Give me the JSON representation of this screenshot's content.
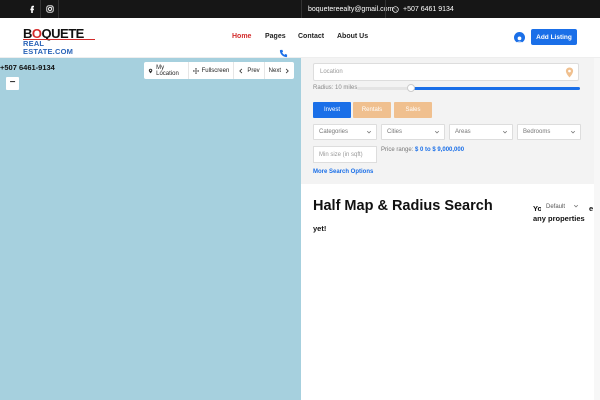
{
  "topbar": {
    "facebook_icon": "facebook-icon",
    "instagram_icon": "instagram-icon",
    "email": "boquetereealty@gmail.com",
    "phone": "+507 6461 9134",
    "bg_color": "#161616"
  },
  "header": {
    "logo": {
      "word1": "BOQUETE",
      "word2": "REAL ESTATE.COM"
    },
    "nav": [
      "Home",
      "Pages",
      "Contact",
      "About Us"
    ],
    "active_nav": "Home",
    "add_listing": "Add Listing",
    "accent_color": "#1a6fe8",
    "active_color": "#d32b2b"
  },
  "map": {
    "phone_text": "+507 6461-9134",
    "zoom_in": "+",
    "zoom_out": "−",
    "controls": [
      "My Location",
      "Fullscreen",
      "Prev",
      "Next"
    ],
    "bg_color": "#a6d0de"
  },
  "search": {
    "location_placeholder": "Location",
    "radius_label": "Radius: 10 miles",
    "radius_fraction": 0.24,
    "tabs": [
      {
        "label": "Invest",
        "active": true
      },
      {
        "label": "Rentals",
        "active": false
      },
      {
        "label": "Sales",
        "active": false
      }
    ],
    "selects": [
      "Categories",
      "Cities",
      "Areas",
      "Bedrooms"
    ],
    "min_size_placeholder": "Min size (in sqft)",
    "price_label": "Price range:",
    "price_value": "$ 0 to $ 9,000,000",
    "more_options": "More Search Options"
  },
  "results": {
    "title": "Half Map & Radius Search",
    "no_props_a": "Yo",
    "no_props_b": "e",
    "no_props_c": "any properties",
    "no_props_d": "yet!",
    "sort_default": "Default"
  }
}
